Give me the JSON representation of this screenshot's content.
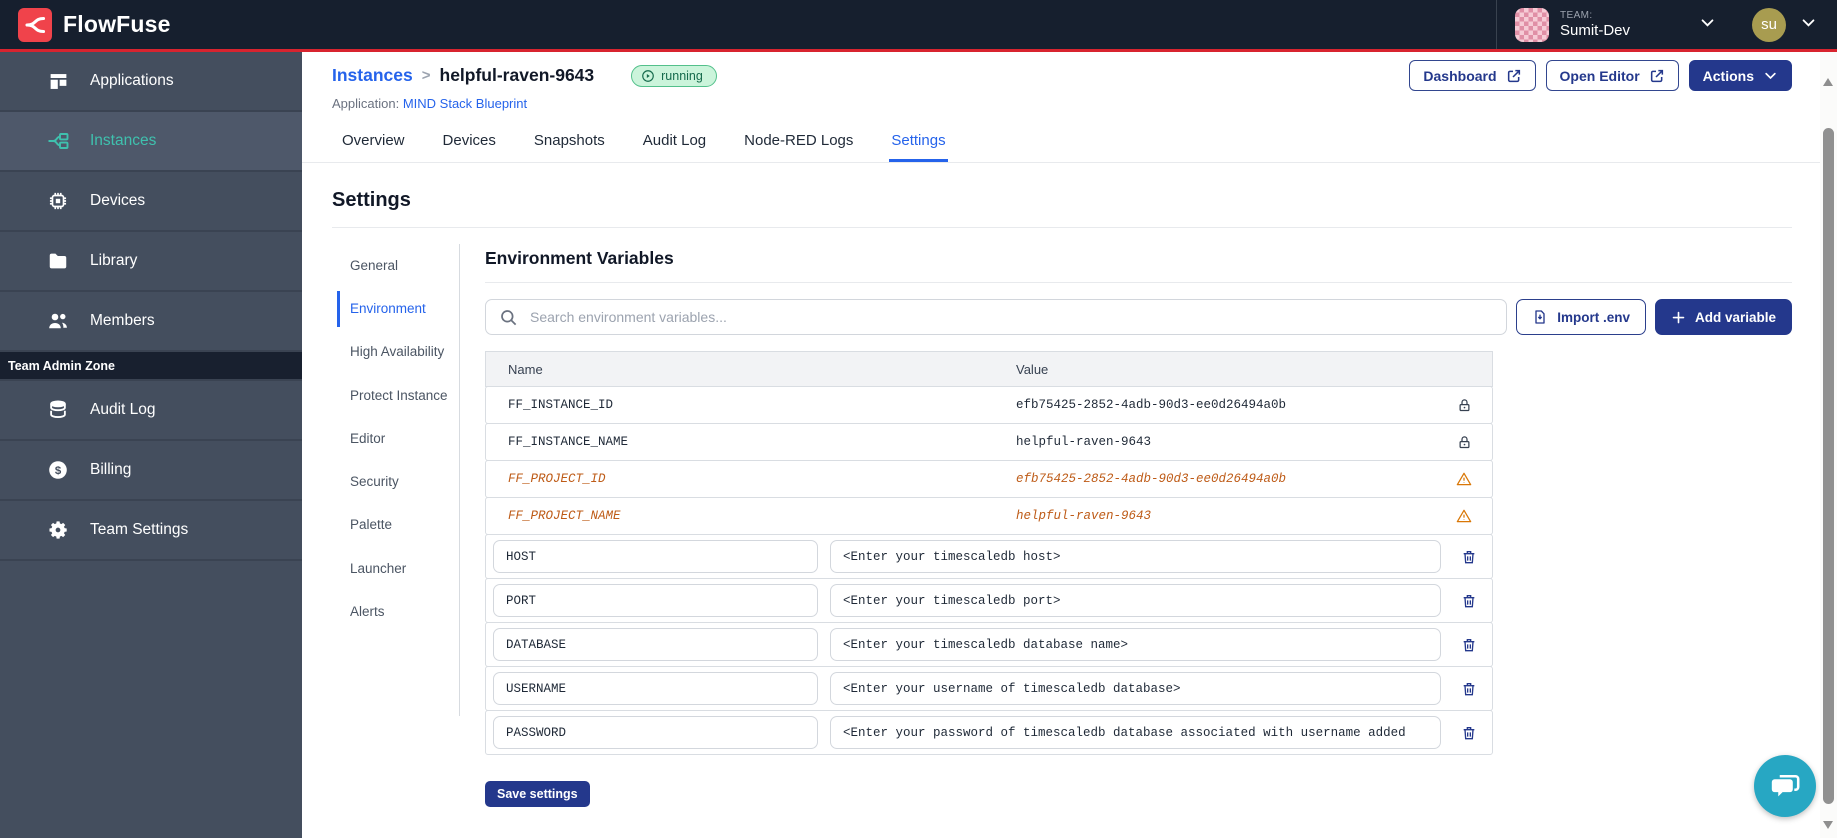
{
  "topbar": {
    "brand": "FlowFuse",
    "team_label": "TEAM:",
    "team_name": "Sumit-Dev",
    "user_initials": "su"
  },
  "sidebar": {
    "items": [
      {
        "label": "Applications",
        "icon": "applications-icon"
      },
      {
        "label": "Instances",
        "icon": "instances-icon"
      },
      {
        "label": "Devices",
        "icon": "devices-icon"
      },
      {
        "label": "Library",
        "icon": "library-icon"
      },
      {
        "label": "Members",
        "icon": "members-icon"
      }
    ],
    "admin_zone_label": "Team Admin Zone",
    "admin_items": [
      {
        "label": "Audit Log",
        "icon": "audit-log-icon"
      },
      {
        "label": "Billing",
        "icon": "billing-icon"
      },
      {
        "label": "Team Settings",
        "icon": "gear-icon"
      }
    ]
  },
  "header": {
    "breadcrumb_parent": "Instances",
    "breadcrumb_separator": ">",
    "instance_name": "helpful-raven-9643",
    "status_badge": "running",
    "application_label": "Application:",
    "application_name": "MIND Stack Blueprint",
    "dashboard_button": "Dashboard",
    "open_editor_button": "Open Editor",
    "actions_button": "Actions"
  },
  "tabs": [
    {
      "label": "Overview",
      "active": false
    },
    {
      "label": "Devices",
      "active": false
    },
    {
      "label": "Snapshots",
      "active": false
    },
    {
      "label": "Audit Log",
      "active": false
    },
    {
      "label": "Node-RED Logs",
      "active": false
    },
    {
      "label": "Settings",
      "active": true
    }
  ],
  "settings": {
    "title": "Settings",
    "subnav": [
      "General",
      "Environment",
      "High Availability",
      "Protect Instance",
      "Editor",
      "Security",
      "Palette",
      "Launcher",
      "Alerts"
    ],
    "active_subnav": "Environment",
    "section_title": "Environment Variables",
    "search_placeholder": "Search environment variables...",
    "import_button": "Import .env",
    "add_button": "Add variable",
    "table": {
      "columns": [
        "Name",
        "Value"
      ],
      "locked_rows": [
        {
          "name": "FF_INSTANCE_ID",
          "value": "efb75425-2852-4adb-90d3-ee0d26494a0b"
        },
        {
          "name": "FF_INSTANCE_NAME",
          "value": "helpful-raven-9643"
        }
      ],
      "deprecated_rows": [
        {
          "name": "FF_PROJECT_ID",
          "value": "efb75425-2852-4adb-90d3-ee0d26494a0b"
        },
        {
          "name": "FF_PROJECT_NAME",
          "value": "helpful-raven-9643"
        }
      ],
      "editable_rows": [
        {
          "name": "HOST",
          "value": "<Enter your timescaledb host>"
        },
        {
          "name": "PORT",
          "value": "<Enter your timescaledb port>"
        },
        {
          "name": "DATABASE",
          "value": "<Enter your timescaledb database name>"
        },
        {
          "name": "USERNAME",
          "value": "<Enter your username of timescaledb database>"
        },
        {
          "name": "PASSWORD",
          "value": "<Enter your password of timescaledb database associated with username added"
        }
      ]
    },
    "save_button": "Save settings"
  },
  "colors": {
    "topbar_bg": "#161F2E",
    "sidebar_bg": "#444E5E",
    "accent_red": "#D8242F",
    "brand_red": "#F0434B",
    "primary_blue": "#24388C",
    "link_blue": "#2563EB",
    "active_teal": "#3FC1AE",
    "warning_orange": "#BE5B17",
    "badge_green_bg": "#CBF4DB",
    "badge_green_text": "#156A4C",
    "chat_teal": "#27A7C3"
  }
}
